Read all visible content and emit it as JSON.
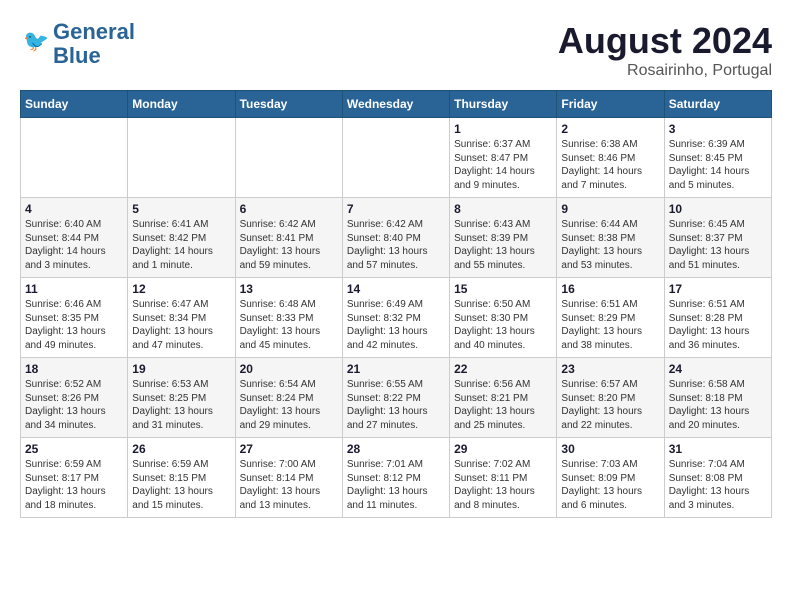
{
  "header": {
    "logo_line1": "General",
    "logo_line2": "Blue",
    "month_year": "August 2024",
    "location": "Rosairinho, Portugal"
  },
  "weekdays": [
    "Sunday",
    "Monday",
    "Tuesday",
    "Wednesday",
    "Thursday",
    "Friday",
    "Saturday"
  ],
  "weeks": [
    [
      {
        "day": "",
        "info": ""
      },
      {
        "day": "",
        "info": ""
      },
      {
        "day": "",
        "info": ""
      },
      {
        "day": "",
        "info": ""
      },
      {
        "day": "1",
        "info": "Sunrise: 6:37 AM\nSunset: 8:47 PM\nDaylight: 14 hours\nand 9 minutes."
      },
      {
        "day": "2",
        "info": "Sunrise: 6:38 AM\nSunset: 8:46 PM\nDaylight: 14 hours\nand 7 minutes."
      },
      {
        "day": "3",
        "info": "Sunrise: 6:39 AM\nSunset: 8:45 PM\nDaylight: 14 hours\nand 5 minutes."
      }
    ],
    [
      {
        "day": "4",
        "info": "Sunrise: 6:40 AM\nSunset: 8:44 PM\nDaylight: 14 hours\nand 3 minutes."
      },
      {
        "day": "5",
        "info": "Sunrise: 6:41 AM\nSunset: 8:42 PM\nDaylight: 14 hours\nand 1 minute."
      },
      {
        "day": "6",
        "info": "Sunrise: 6:42 AM\nSunset: 8:41 PM\nDaylight: 13 hours\nand 59 minutes."
      },
      {
        "day": "7",
        "info": "Sunrise: 6:42 AM\nSunset: 8:40 PM\nDaylight: 13 hours\nand 57 minutes."
      },
      {
        "day": "8",
        "info": "Sunrise: 6:43 AM\nSunset: 8:39 PM\nDaylight: 13 hours\nand 55 minutes."
      },
      {
        "day": "9",
        "info": "Sunrise: 6:44 AM\nSunset: 8:38 PM\nDaylight: 13 hours\nand 53 minutes."
      },
      {
        "day": "10",
        "info": "Sunrise: 6:45 AM\nSunset: 8:37 PM\nDaylight: 13 hours\nand 51 minutes."
      }
    ],
    [
      {
        "day": "11",
        "info": "Sunrise: 6:46 AM\nSunset: 8:35 PM\nDaylight: 13 hours\nand 49 minutes."
      },
      {
        "day": "12",
        "info": "Sunrise: 6:47 AM\nSunset: 8:34 PM\nDaylight: 13 hours\nand 47 minutes."
      },
      {
        "day": "13",
        "info": "Sunrise: 6:48 AM\nSunset: 8:33 PM\nDaylight: 13 hours\nand 45 minutes."
      },
      {
        "day": "14",
        "info": "Sunrise: 6:49 AM\nSunset: 8:32 PM\nDaylight: 13 hours\nand 42 minutes."
      },
      {
        "day": "15",
        "info": "Sunrise: 6:50 AM\nSunset: 8:30 PM\nDaylight: 13 hours\nand 40 minutes."
      },
      {
        "day": "16",
        "info": "Sunrise: 6:51 AM\nSunset: 8:29 PM\nDaylight: 13 hours\nand 38 minutes."
      },
      {
        "day": "17",
        "info": "Sunrise: 6:51 AM\nSunset: 8:28 PM\nDaylight: 13 hours\nand 36 minutes."
      }
    ],
    [
      {
        "day": "18",
        "info": "Sunrise: 6:52 AM\nSunset: 8:26 PM\nDaylight: 13 hours\nand 34 minutes."
      },
      {
        "day": "19",
        "info": "Sunrise: 6:53 AM\nSunset: 8:25 PM\nDaylight: 13 hours\nand 31 minutes."
      },
      {
        "day": "20",
        "info": "Sunrise: 6:54 AM\nSunset: 8:24 PM\nDaylight: 13 hours\nand 29 minutes."
      },
      {
        "day": "21",
        "info": "Sunrise: 6:55 AM\nSunset: 8:22 PM\nDaylight: 13 hours\nand 27 minutes."
      },
      {
        "day": "22",
        "info": "Sunrise: 6:56 AM\nSunset: 8:21 PM\nDaylight: 13 hours\nand 25 minutes."
      },
      {
        "day": "23",
        "info": "Sunrise: 6:57 AM\nSunset: 8:20 PM\nDaylight: 13 hours\nand 22 minutes."
      },
      {
        "day": "24",
        "info": "Sunrise: 6:58 AM\nSunset: 8:18 PM\nDaylight: 13 hours\nand 20 minutes."
      }
    ],
    [
      {
        "day": "25",
        "info": "Sunrise: 6:59 AM\nSunset: 8:17 PM\nDaylight: 13 hours\nand 18 minutes."
      },
      {
        "day": "26",
        "info": "Sunrise: 6:59 AM\nSunset: 8:15 PM\nDaylight: 13 hours\nand 15 minutes."
      },
      {
        "day": "27",
        "info": "Sunrise: 7:00 AM\nSunset: 8:14 PM\nDaylight: 13 hours\nand 13 minutes."
      },
      {
        "day": "28",
        "info": "Sunrise: 7:01 AM\nSunset: 8:12 PM\nDaylight: 13 hours\nand 11 minutes."
      },
      {
        "day": "29",
        "info": "Sunrise: 7:02 AM\nSunset: 8:11 PM\nDaylight: 13 hours\nand 8 minutes."
      },
      {
        "day": "30",
        "info": "Sunrise: 7:03 AM\nSunset: 8:09 PM\nDaylight: 13 hours\nand 6 minutes."
      },
      {
        "day": "31",
        "info": "Sunrise: 7:04 AM\nSunset: 8:08 PM\nDaylight: 13 hours\nand 3 minutes."
      }
    ]
  ]
}
